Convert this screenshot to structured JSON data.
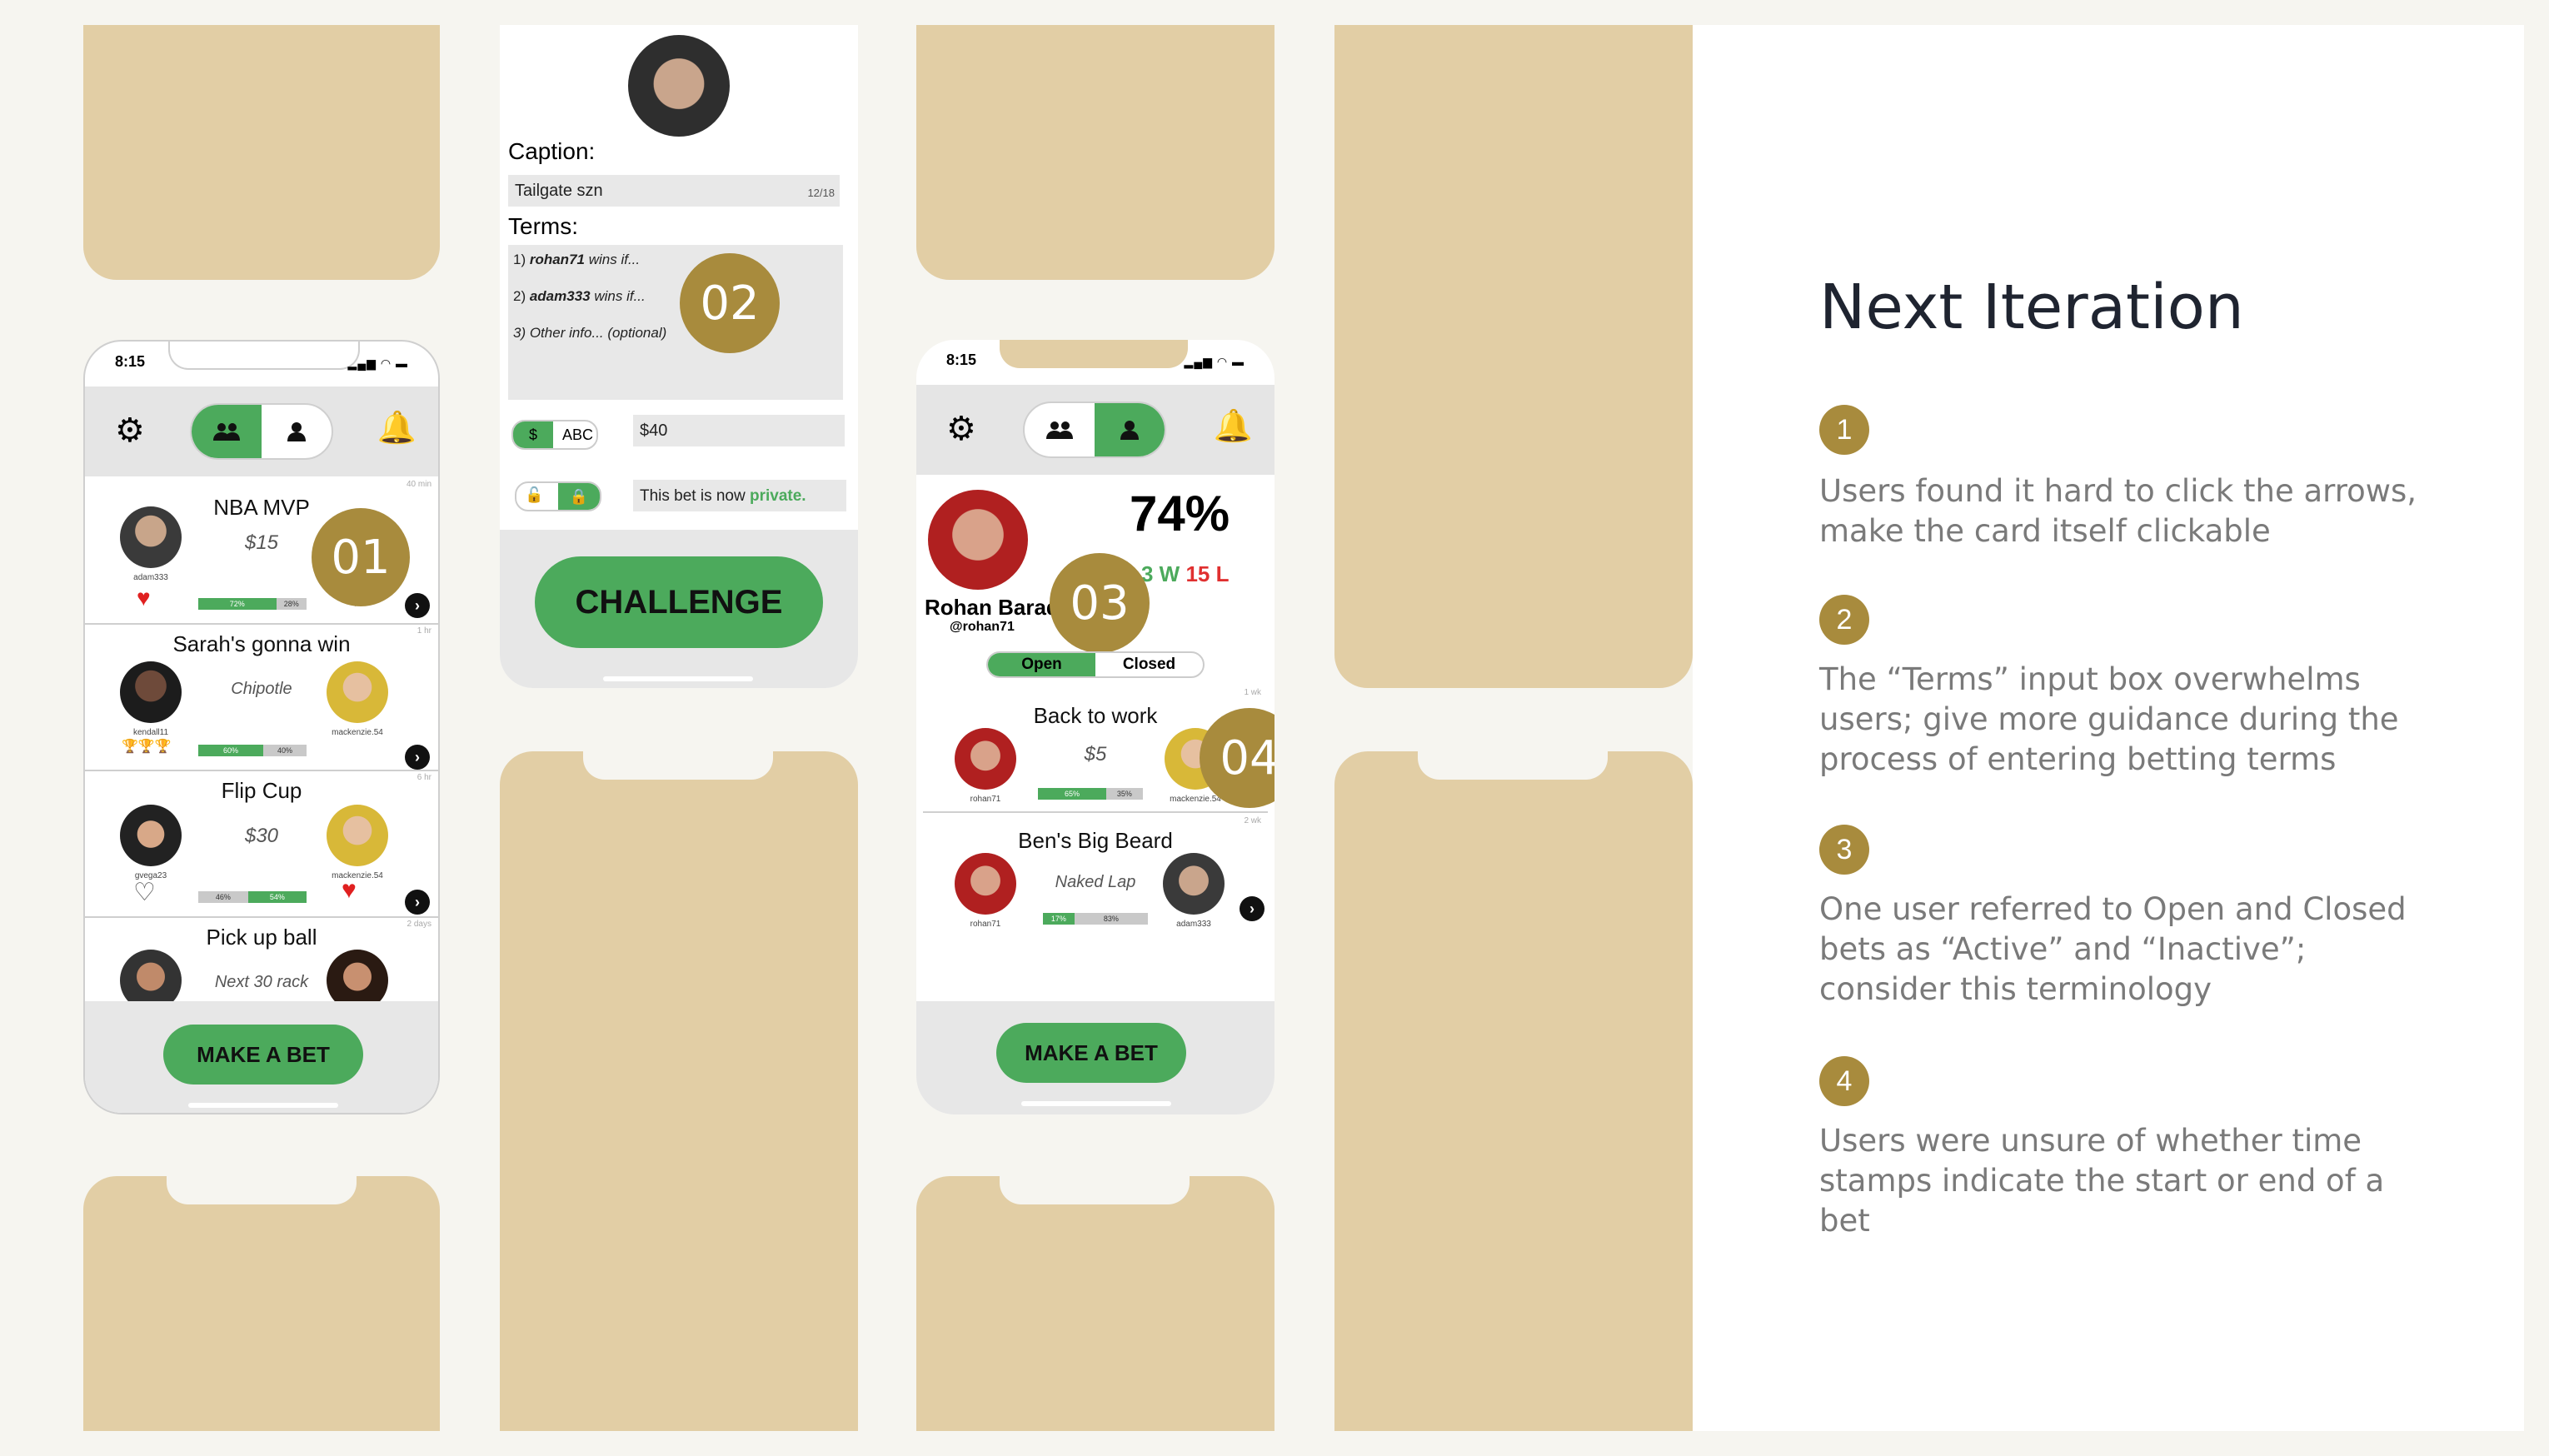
{
  "colors": {
    "accent_green": "#4caa5c",
    "tan_placeholder": "#e2cea5",
    "badge_gold": "#a88b3d",
    "loss_red": "#e03030"
  },
  "phone1": {
    "time": "8:15",
    "cards": [
      {
        "title": "NBA MVP",
        "stake": "$15",
        "user_left": "adam333",
        "pct_left": "72%",
        "pct_right": "28%",
        "badge": "01",
        "stamp": "40 min"
      },
      {
        "title": "Sarah's gonna win",
        "stake": "Chipotle",
        "user_left": "kendall11",
        "user_right": "mackenzie.54",
        "pct_left": "60%",
        "pct_right": "40%",
        "stamp": "1 hr"
      },
      {
        "title": "Flip Cup",
        "stake": "$30",
        "user_left": "gvega23",
        "user_right": "mackenzie.54",
        "pct_left": "46%",
        "pct_right": "54%",
        "stamp": "6 hr"
      },
      {
        "title": "Pick up ball",
        "stake": "Next 30 rack",
        "stamp": "2 days"
      }
    ],
    "cta": "MAKE A BET"
  },
  "phone2": {
    "caption_label": "Caption:",
    "caption_value": "Tailgate szn",
    "caption_count": "12/18",
    "terms_label": "Terms:",
    "term1_user": "rohan71",
    "term1_rest": " wins if...",
    "term2_user": "adam333",
    "term2_rest": " wins if...",
    "term3": "3) Other info... (optional)",
    "term1_prefix": "1) ",
    "term2_prefix": "2) ",
    "badge": "02",
    "toggle_dollar": "$",
    "toggle_abc": "ABC",
    "amount": "$40",
    "private_text": "This bet is now ",
    "private_word": "private.",
    "cta": "CHALLENGE"
  },
  "phone3": {
    "time": "8:15",
    "pct": "74%",
    "wins": "3 W",
    "losses": "15 L",
    "name": "Rohan Barad",
    "handle": "@rohan71",
    "badge3": "03",
    "tab_open": "Open",
    "tab_closed": "Closed",
    "cards": [
      {
        "title": "Back to work",
        "stake": "$5",
        "user_left": "rohan71",
        "user_right": "mackenzie.54",
        "pct_left": "65%",
        "pct_right": "35%",
        "badge": "04",
        "stamp": "1 wk"
      },
      {
        "title": "Ben's Big Beard",
        "stake": "Naked Lap",
        "user_left": "rohan71",
        "user_right": "adam333",
        "pct_left": "17%",
        "pct_right": "83%",
        "stamp": "2 wk"
      }
    ],
    "cta": "MAKE A BET"
  },
  "panel": {
    "title": "Next Iteration",
    "items": [
      {
        "num": "1",
        "text": "Users found it hard to click the arrows, make the card itself clickable"
      },
      {
        "num": "2",
        "text": "The “Terms” input box overwhelms users; give more guidance during the process of entering betting terms"
      },
      {
        "num": "3",
        "text": "One user referred to Open and Closed bets as “Active” and “Inactive”; consider this terminology"
      },
      {
        "num": "4",
        "text": "Users were unsure of whether time stamps indicate the start or end of a bet"
      }
    ]
  }
}
